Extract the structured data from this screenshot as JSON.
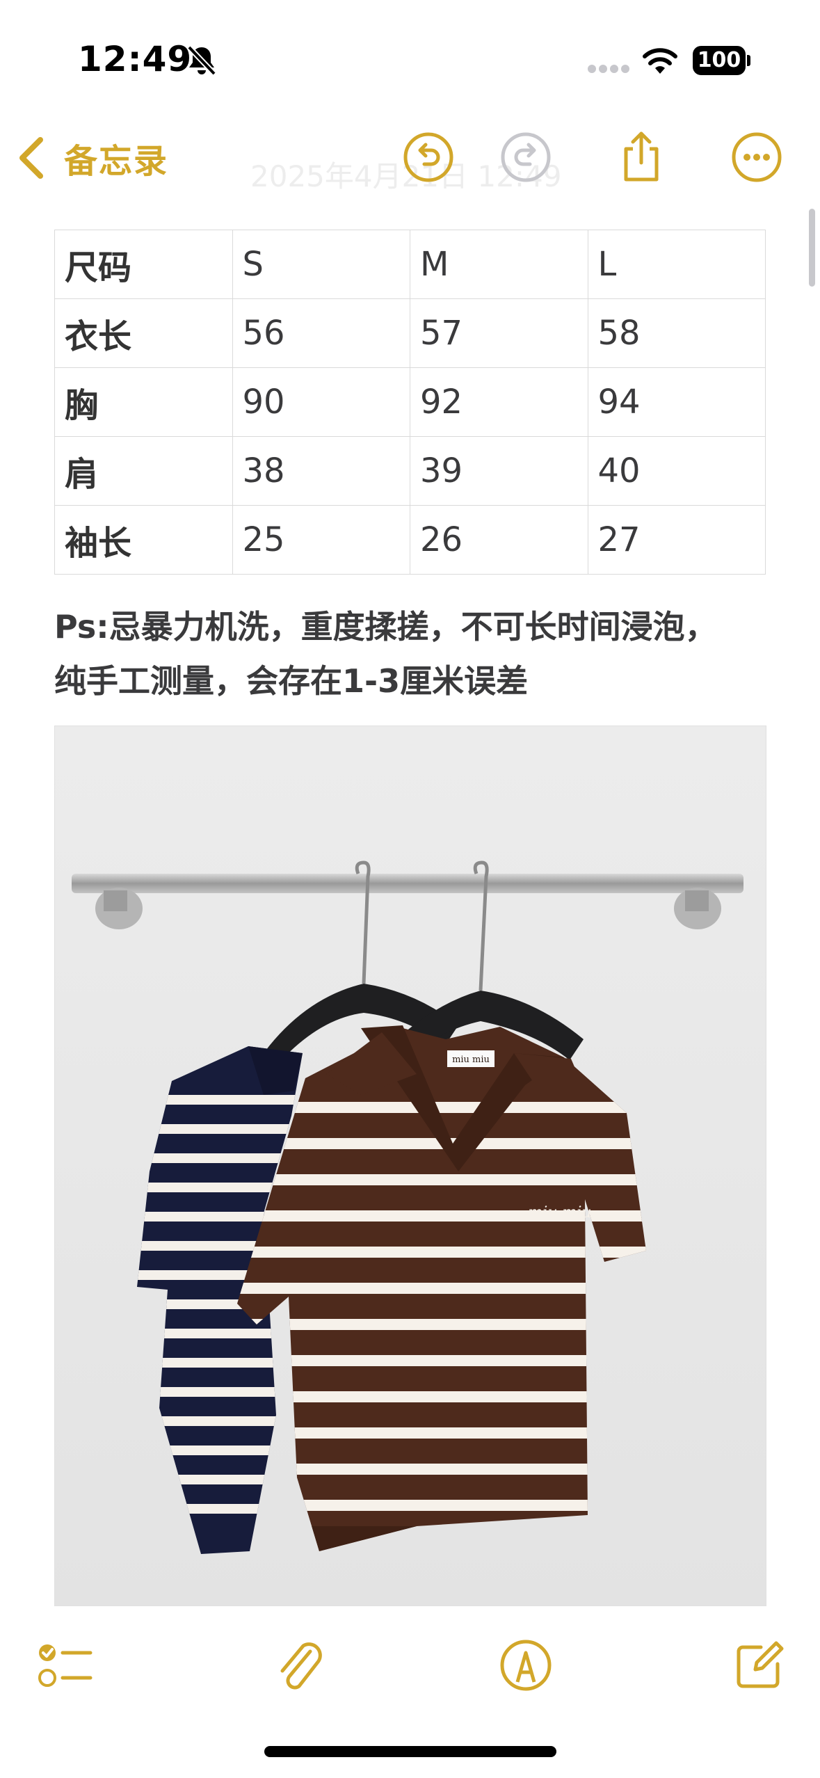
{
  "status_bar": {
    "time": "12:49",
    "battery": "100",
    "icons": [
      "bell-slash-icon",
      "signal-icon",
      "wifi-icon",
      "battery-icon"
    ]
  },
  "nav": {
    "back_label": "备忘录",
    "date_faded": "2025年4月21日 12:49",
    "buttons": [
      "undo-icon",
      "redo-icon",
      "share-icon",
      "more-icon"
    ],
    "accent_color": "#D2A72A"
  },
  "table": {
    "rows": [
      [
        "尺码",
        "S",
        "M",
        "L"
      ],
      [
        "衣长",
        "56",
        "57",
        "58"
      ],
      [
        "胸",
        "90",
        "92",
        "94"
      ],
      [
        "肩",
        "38",
        "39",
        "40"
      ],
      [
        "袖长",
        "25",
        "26",
        "27"
      ]
    ]
  },
  "note": {
    "line1": "Ps:忌暴力机洗，重度揉搓，不可长时间浸泡，",
    "line2": "纯手工测量，会存在1-3厘米误差"
  },
  "photo": {
    "label_tag": "miu miu",
    "label_chest": "miu miu"
  },
  "toolbar": {
    "buttons": [
      "checklist-icon",
      "paperclip-icon",
      "markup-pen-icon",
      "compose-icon"
    ]
  }
}
